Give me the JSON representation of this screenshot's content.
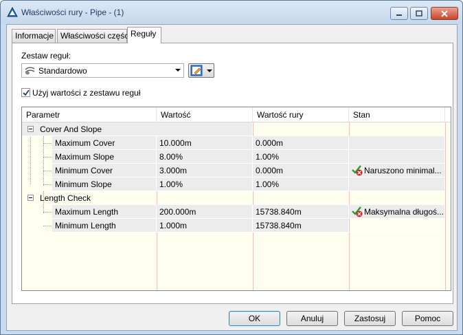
{
  "window": {
    "title": "Właściwości rury - Pipe - (1)"
  },
  "tabs": [
    {
      "label": "Informacje",
      "active": false
    },
    {
      "label": "Właściwości części",
      "active": false
    },
    {
      "label": "Reguły",
      "active": true
    }
  ],
  "ruleset": {
    "label": "Zestaw reguł:",
    "selected": "Standardowo",
    "use_values_label": "Użyj wartości z zestawu reguł",
    "use_values_checked": true
  },
  "grid": {
    "columns": [
      "Parametr",
      "Wartość",
      "Wartość rury",
      "Stan"
    ],
    "groups": [
      {
        "name": "Cover And Slope",
        "rows": [
          {
            "param": "Maximum Cover",
            "value": "10.000m",
            "pipe_value": "0.000m",
            "status": ""
          },
          {
            "param": "Maximum Slope",
            "value": "8.00%",
            "pipe_value": "1.00%",
            "status": ""
          },
          {
            "param": "Minimum Cover",
            "value": "3.000m",
            "pipe_value": "0.000m",
            "status": "Naruszono minimal..."
          },
          {
            "param": "Minimum Slope",
            "value": "1.00%",
            "pipe_value": "1.00%",
            "status": ""
          }
        ]
      },
      {
        "name": "Length Check",
        "rows": [
          {
            "param": "Maximum Length",
            "value": "200.000m",
            "pipe_value": "15738.840m",
            "status": "Maksymalna długoś..."
          },
          {
            "param": "Minimum Length",
            "value": "1.000m",
            "pipe_value": "15738.840m",
            "status": ""
          }
        ]
      }
    ]
  },
  "buttons": {
    "ok": "OK",
    "cancel": "Anuluj",
    "apply": "Zastosuj",
    "help": "Pomoc"
  },
  "colors": {
    "grid_background": "#fffff0",
    "row_background": "#ececec",
    "warning_red": "#d02020",
    "check_green": "#2e9a2e"
  }
}
